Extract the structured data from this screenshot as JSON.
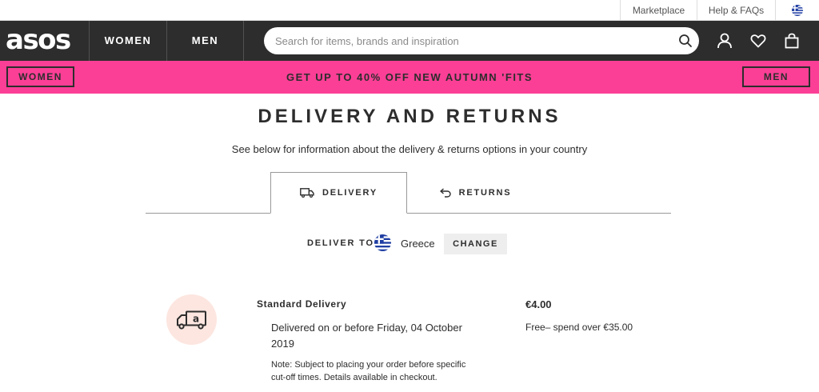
{
  "utility_bar": {
    "marketplace": "Marketplace",
    "help": "Help & FAQs",
    "country_flag_icon": "greece-flag-icon"
  },
  "header": {
    "logo": "asos",
    "nav": [
      "WOMEN",
      "MEN"
    ],
    "search_placeholder": "Search for items, brands and inspiration",
    "icons": [
      "search-icon",
      "account-icon",
      "heart-icon",
      "bag-icon"
    ]
  },
  "promo": {
    "women_button": "WOMEN",
    "text": "GET UP TO 40% OFF NEW AUTUMN 'FITS",
    "men_button": "MEN",
    "background_color": "#fb3f96"
  },
  "page": {
    "title": "DELIVERY AND RETURNS",
    "subtitle": "See below for information about the delivery & returns options in your country",
    "tabs": [
      {
        "label": "DELIVERY",
        "icon": "truck-icon",
        "active": true
      },
      {
        "label": "RETURNS",
        "icon": "return-arrow-icon",
        "active": false
      }
    ],
    "deliver_to_label": "DELIVER TO",
    "country": "Greece",
    "change_button": "CHANGE"
  },
  "delivery_option": {
    "name": "Standard Delivery",
    "date": "Delivered on or before Friday, 04 October 2019",
    "note": "Note: Subject to placing your order before specific cut-off times. Details available in checkout.",
    "price": "€4.00",
    "free_threshold": "Free– spend over €35.00",
    "icon_bg_color": "#fde6e0"
  }
}
